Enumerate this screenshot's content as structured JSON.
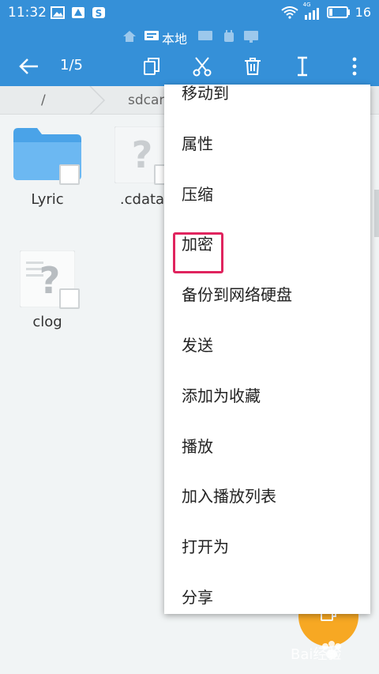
{
  "status_bar": {
    "time": "11:32",
    "battery": "16",
    "net_badge": "4G"
  },
  "location_bar": {
    "label": "本地"
  },
  "toolbar": {
    "count": "1/5"
  },
  "breadcrumb": {
    "items": [
      "/",
      "sdcar"
    ]
  },
  "files": [
    {
      "name": "Lyric",
      "type": "folder"
    },
    {
      "name": ".cdata",
      "type": "unknown"
    },
    {
      "name": "clog",
      "type": "unknown"
    }
  ],
  "context_menu": {
    "items": [
      "移动到",
      "属性",
      "压缩",
      "加密",
      "备份到网络硬盘",
      "发送",
      "添加为收藏",
      "播放",
      "加入播放列表",
      "打开为",
      "分享"
    ],
    "highlighted": "加密"
  },
  "watermark": {
    "text": "Bai经验"
  },
  "colors": {
    "primary": "#3590d8",
    "fab": "#f7a823",
    "highlight": "#e0245e"
  }
}
